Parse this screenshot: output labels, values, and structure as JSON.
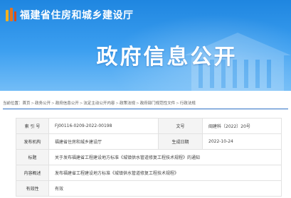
{
  "header": {
    "site_title": "福建省住房和城乡建设厅",
    "page_heading": "政府信息公开",
    "brand_color": "#1f86e0"
  },
  "breadcrumb": {
    "prefix": "当前位置：",
    "items": [
      "首页",
      "政务公开",
      "政府信息公开",
      "法定主动公开内容",
      "政策法规",
      "政府部门规范性文件",
      "行政法规"
    ]
  },
  "info_table": {
    "index_label": "索 引 号",
    "index_value": "FJ00116-0209-2022-00198",
    "doc_no_label": "文号",
    "doc_no_value": "闽建科〔2022〕20号",
    "publisher_label": "发布机构",
    "publisher_value": "福建省住房和城乡建设厅",
    "date_label": "生成日期",
    "date_value": "2022-10-24",
    "title_label": "标题",
    "title_value": "关于发布福建省工程建设地方标准《城镇供水管道修复工程技术规程》的通知",
    "summary_label": "内容概述",
    "summary_value": "发布福建省工程建设地方标准《城镇供水管道修复工程技术规程》",
    "validity_label": "有效性",
    "validity_value": "有效"
  }
}
